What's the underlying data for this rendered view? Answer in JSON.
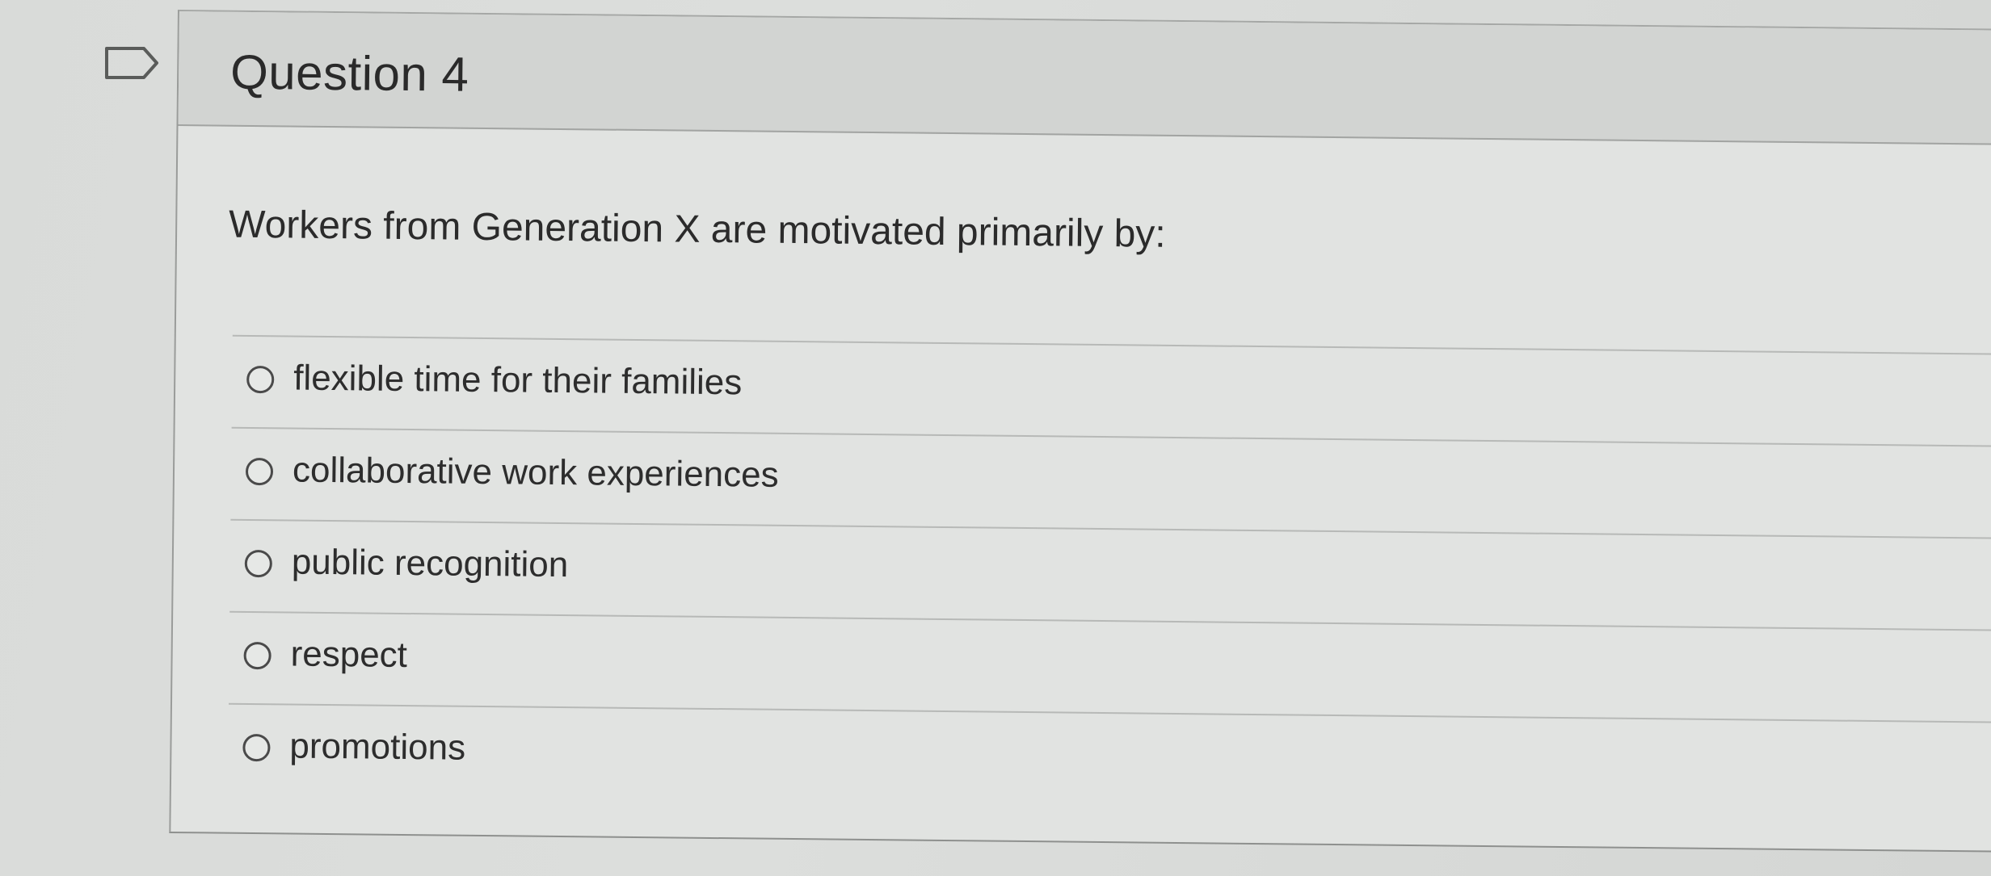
{
  "question": {
    "title": "Question 4",
    "prompt": "Workers from Generation X are motivated primarily by:",
    "options": [
      {
        "label": "flexible time for their families",
        "selected": false
      },
      {
        "label": "collaborative work experiences",
        "selected": false
      },
      {
        "label": "public recognition",
        "selected": false
      },
      {
        "label": "respect",
        "selected": false
      },
      {
        "label": "promotions",
        "selected": false
      }
    ]
  },
  "icons": {
    "flag": "flag-outline-icon"
  },
  "colors": {
    "background": "#d6d8d6",
    "header": "#d2d4d2",
    "text": "#2a2a2a"
  }
}
